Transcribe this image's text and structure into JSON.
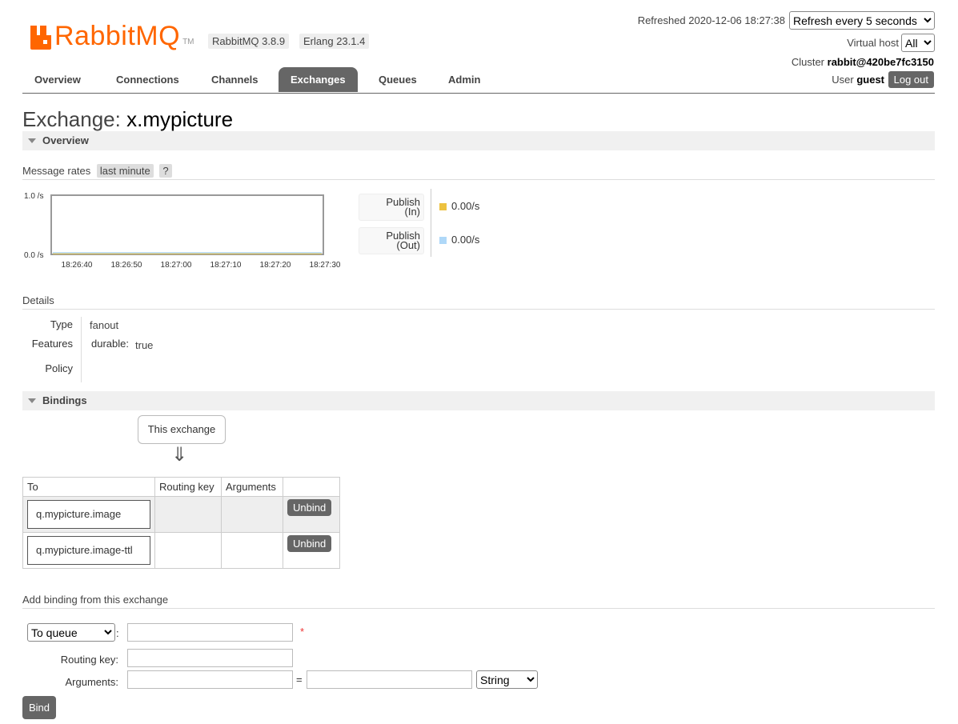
{
  "header": {
    "logo_text": "RabbitMQ",
    "logo_tm": "TM",
    "rabbitmq_version": "RabbitMQ 3.8.9",
    "erlang_version": "Erlang 23.1.4",
    "refreshed": "Refreshed 2020-12-06 18:27:38",
    "refresh_select": "Refresh every 5 seconds",
    "virtual_host_label": "Virtual host",
    "virtual_host_value": "All",
    "cluster_label": "Cluster",
    "cluster_name": "rabbit@420be7fc3150",
    "user_label": "User",
    "user_name": "guest",
    "logout_label": "Log out",
    "brand_color": "#ff6600"
  },
  "nav": {
    "tabs": [
      {
        "label": "Overview"
      },
      {
        "label": "Connections"
      },
      {
        "label": "Channels"
      },
      {
        "label": "Exchanges",
        "active": true
      },
      {
        "label": "Queues"
      },
      {
        "label": "Admin"
      }
    ]
  },
  "page": {
    "title_prefix": "Exchange:",
    "title_name": "x.mypicture"
  },
  "overview": {
    "section_label": "Overview",
    "message_rates_label": "Message rates",
    "range_label": "last minute",
    "help_label": "?",
    "chart_data": {
      "type": "line",
      "x": [
        "18:26:40",
        "18:26:50",
        "18:27:00",
        "18:27:10",
        "18:27:20",
        "18:27:30"
      ],
      "ylim": [
        0.0,
        1.0
      ],
      "yticks": [
        "1.0 /s",
        "0.0 /s"
      ],
      "series": [
        {
          "name": "Publish (In)",
          "values": [
            0,
            0,
            0,
            0,
            0,
            0
          ],
          "color": "#edc240"
        },
        {
          "name": "Publish (Out)",
          "values": [
            0,
            0,
            0,
            0,
            0,
            0
          ],
          "color": "#afd8f8"
        }
      ]
    },
    "legend": [
      {
        "line1": "Publish",
        "line2": "(In)",
        "rate": "0.00/s",
        "color": "#edc240"
      },
      {
        "line1": "Publish",
        "line2": "(Out)",
        "rate": "0.00/s",
        "color": "#afd8f8"
      }
    ]
  },
  "details": {
    "heading": "Details",
    "type_label": "Type",
    "type_value": "fanout",
    "features_label": "Features",
    "feature_key": "durable:",
    "feature_value": "true",
    "policy_label": "Policy"
  },
  "bindings": {
    "section_label": "Bindings",
    "this_exchange": "This exchange",
    "arrow": "⇓",
    "columns": [
      "To",
      "Routing key",
      "Arguments",
      ""
    ],
    "rows": [
      {
        "to": "q.mypicture.image",
        "action": "Unbind"
      },
      {
        "to": "q.mypicture.image-ttl",
        "action": "Unbind"
      }
    ]
  },
  "add_binding": {
    "heading": "Add binding from this exchange",
    "destination_type": "To queue",
    "required_mark": "*",
    "routing_key_label": "Routing key:",
    "arguments_label": "Arguments:",
    "equals": "=",
    "arg_type": "String",
    "bind_label": "Bind"
  }
}
